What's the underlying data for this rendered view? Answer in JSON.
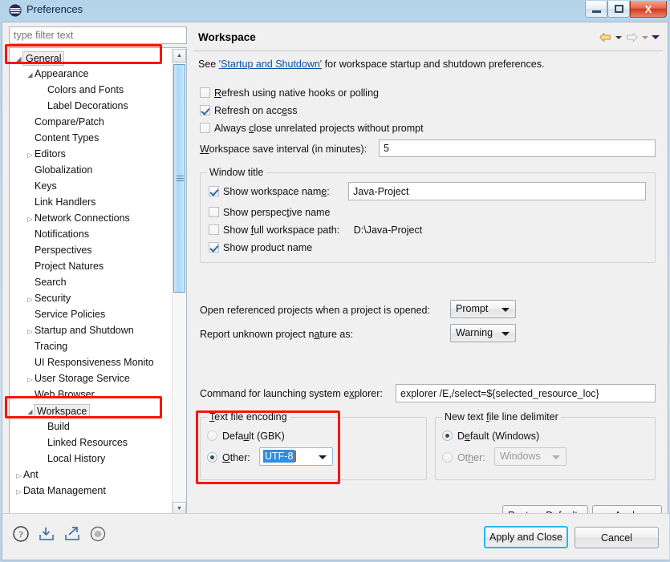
{
  "window": {
    "title": "Preferences",
    "icon": "eclipse-icon",
    "buttons": {
      "minimize": "minimize-icon",
      "restore": "restore-icon",
      "close": "X"
    }
  },
  "sidebar": {
    "filter_placeholder": "type filter text",
    "filter_value": "",
    "items": [
      {
        "label": "General",
        "indent": 0,
        "arrow": "expanded",
        "selected": true
      },
      {
        "label": "Appearance",
        "indent": 1,
        "arrow": "expanded",
        "selected": false
      },
      {
        "label": "Colors and Fonts",
        "indent": 2,
        "arrow": "none",
        "selected": false
      },
      {
        "label": "Label Decorations",
        "indent": 2,
        "arrow": "none",
        "selected": false
      },
      {
        "label": "Compare/Patch",
        "indent": 1,
        "arrow": "none",
        "selected": false
      },
      {
        "label": "Content Types",
        "indent": 1,
        "arrow": "none",
        "selected": false
      },
      {
        "label": "Editors",
        "indent": 1,
        "arrow": "collapsed",
        "selected": false
      },
      {
        "label": "Globalization",
        "indent": 1,
        "arrow": "none",
        "selected": false
      },
      {
        "label": "Keys",
        "indent": 1,
        "arrow": "none",
        "selected": false
      },
      {
        "label": "Link Handlers",
        "indent": 1,
        "arrow": "none",
        "selected": false
      },
      {
        "label": "Network Connections",
        "indent": 1,
        "arrow": "collapsed",
        "selected": false
      },
      {
        "label": "Notifications",
        "indent": 1,
        "arrow": "none",
        "selected": false
      },
      {
        "label": "Perspectives",
        "indent": 1,
        "arrow": "none",
        "selected": false
      },
      {
        "label": "Project Natures",
        "indent": 1,
        "arrow": "none",
        "selected": false
      },
      {
        "label": "Search",
        "indent": 1,
        "arrow": "none",
        "selected": false
      },
      {
        "label": "Security",
        "indent": 1,
        "arrow": "collapsed",
        "selected": false
      },
      {
        "label": "Service Policies",
        "indent": 1,
        "arrow": "none",
        "selected": false
      },
      {
        "label": "Startup and Shutdown",
        "indent": 1,
        "arrow": "collapsed",
        "selected": false
      },
      {
        "label": "Tracing",
        "indent": 1,
        "arrow": "none",
        "selected": false
      },
      {
        "label": "UI Responsiveness Monito",
        "indent": 1,
        "arrow": "none",
        "selected": false
      },
      {
        "label": "User Storage Service",
        "indent": 1,
        "arrow": "collapsed",
        "selected": false
      },
      {
        "label": "Web Browser",
        "indent": 1,
        "arrow": "none",
        "selected": false
      },
      {
        "label": "Workspace",
        "indent": 1,
        "arrow": "expanded",
        "selected": true
      },
      {
        "label": "Build",
        "indent": 2,
        "arrow": "none",
        "selected": false
      },
      {
        "label": "Linked Resources",
        "indent": 2,
        "arrow": "none",
        "selected": false
      },
      {
        "label": "Local History",
        "indent": 2,
        "arrow": "none",
        "selected": false
      },
      {
        "label": "Ant",
        "indent": 0,
        "arrow": "collapsed",
        "selected": false
      },
      {
        "label": "Data Management",
        "indent": 0,
        "arrow": "collapsed",
        "selected": false
      }
    ]
  },
  "panel": {
    "title": "Workspace",
    "nav": {
      "back": "back-arrow-icon",
      "forward": "forward-arrow-icon",
      "menu": "view-menu-icon"
    },
    "see_prefix": "See ",
    "see_link": "'Startup and Shutdown'",
    "see_suffix": " for workspace startup and shutdown preferences.",
    "checkboxes": [
      {
        "label_pre": "R",
        "label_key": "e",
        "label_post": "fresh using native hooks or polling",
        "checked": false
      },
      {
        "label_pre": "Refresh on acc",
        "label_key": "e",
        "label_post": "ss",
        "checked": true
      },
      {
        "label_pre": "Always ",
        "label_key": "c",
        "label_post": "lose unrelated projects without prompt",
        "checked": false
      }
    ],
    "save_interval": {
      "label_pre": "W",
      "label_key": "",
      "label_post": "orkspace save interval (in minutes):",
      "value": "5"
    },
    "window_title_group": {
      "title_pre": "Window title",
      "title": "Window title",
      "show_workspace_name": {
        "label": "Show workspace nam",
        "label_key": "e",
        "label_suffix": ":",
        "checked": true,
        "value": "Java-Project"
      },
      "show_perspective_name": {
        "label_pre": "Show perspec",
        "label_key": "t",
        "label_post": "ive name",
        "checked": false
      },
      "show_full_workspace_path": {
        "label_pre": "Show ",
        "label_key": "f",
        "label_post": "ull workspace path:",
        "checked": false,
        "value": "D:\\Java-Project"
      },
      "show_product_name": {
        "label": "Show product name",
        "checked": true
      }
    },
    "open_referenced": {
      "label": "Open referenced projects when a project is opened:",
      "value": "Prompt"
    },
    "report_nature": {
      "label_pre": "Report unknown project n",
      "label_key": "a",
      "label_post": "ture as:",
      "value": "Warning"
    },
    "command_explorer": {
      "label_pre": "Command for launching system e",
      "label_key": "x",
      "label_post": "plorer:",
      "value": "explorer /E,/select=${selected_resource_loc}"
    },
    "text_file_encoding": {
      "group_key": "T",
      "group_title_rest": "ext file encoding",
      "default_label_pre": "Defa",
      "default_label_key": "u",
      "default_label_post": "lt (GBK)",
      "default_selected": false,
      "other_label_key": "O",
      "other_label_rest": "ther:",
      "other_selected": true,
      "other_value": "UTF-8"
    },
    "line_delimiter": {
      "group_pre": "New text ",
      "group_key": "f",
      "group_post": "ile line delimiter",
      "default_label_pre": "D",
      "default_label_key": "e",
      "default_label_post": "fault (Windows)",
      "default_selected": true,
      "other_label_pre": "Ot",
      "other_label_key": "h",
      "other_label_post": "er:",
      "other_selected": false,
      "other_value": "Windows"
    },
    "restore_defaults": {
      "pre": "Restore ",
      "key": "D",
      "post": "efaults"
    },
    "apply": {
      "pre": "",
      "key": "A",
      "post": "pply"
    }
  },
  "footer": {
    "icons": [
      "help-icon",
      "import-icon",
      "export-icon",
      "info-icon"
    ],
    "apply_and_close": "Apply and Close",
    "cancel": "Cancel"
  },
  "colors": {
    "annotation_red": "#f41707",
    "link_blue": "#0b4ea2",
    "selection_blue": "#2f8ee0",
    "primary_border": "#29b6e8"
  }
}
